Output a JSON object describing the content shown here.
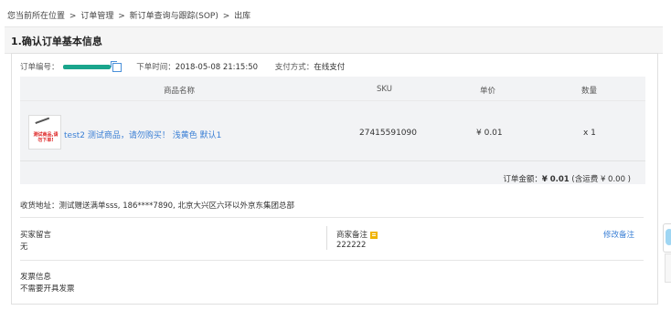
{
  "breadcrumb": [
    "您当前所在位置",
    ">",
    "订单管理",
    ">",
    "新订单查询与跟踪(SOP)",
    ">",
    "出库"
  ],
  "section_title": "1.确认订单基本信息",
  "order": {
    "id_label": "订单编号：",
    "time_label": "下单时间：",
    "time_value": "2018-05-08 21:15:50",
    "pay_label": "支付方式：",
    "pay_value": "在线支付"
  },
  "table": {
    "headers": [
      "商品名称",
      "SKU",
      "单价",
      "数量"
    ],
    "rows": [
      {
        "name": "test2 测试商品，请勿购买！ 浅黄色 默认1",
        "sku": "27415591090",
        "price": "¥ 0.01",
        "qty": "x 1",
        "thumb_text": "测试商品,请勿下单!"
      }
    ]
  },
  "total": {
    "label": "订单金额：",
    "amount": "¥ 0.01",
    "freight": " (含运费 ¥ 0.00 )"
  },
  "address": {
    "label": "收货地址：",
    "value": "测试赠送满单sss, 186****7890, 北京大兴区六环以外京东集团总部"
  },
  "buyer_note": {
    "label": "买家留言",
    "value": "无"
  },
  "seller_note": {
    "label": "商家备注",
    "value": "222222",
    "edit": "修改备注"
  },
  "invoice": {
    "label": "发票信息",
    "value": "不需要开具发票"
  },
  "colors": {
    "link": "#3a7fd5",
    "flag": "#f0b400",
    "mask": "#1aa58c"
  }
}
